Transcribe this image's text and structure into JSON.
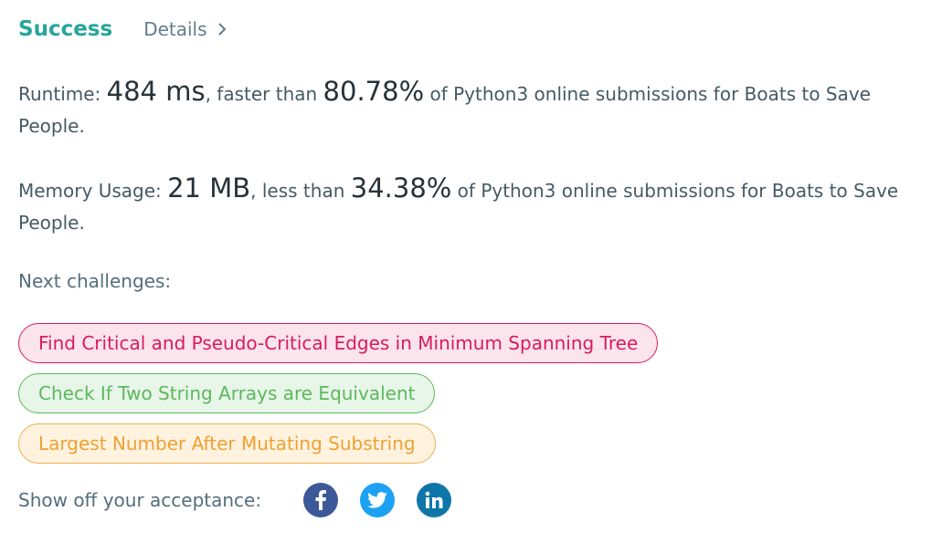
{
  "header": {
    "status": "Success",
    "details_label": "Details"
  },
  "runtime": {
    "label": "Runtime:",
    "value": "484 ms",
    "comparison": ", faster than ",
    "percent": "80.78%",
    "suffix": " of Python3 online submissions for Boats to Save People."
  },
  "memory": {
    "label": "Memory Usage:",
    "value": "21 MB",
    "comparison": ", less than ",
    "percent": "34.38%",
    "suffix": " of Python3 online submissions for Boats to Save People."
  },
  "next": {
    "label": "Next challenges:",
    "items": [
      {
        "title": "Find Critical and Pseudo-Critical Edges in Minimum Spanning Tree",
        "difficulty_color": "#d81b60"
      },
      {
        "title": "Check If Two String Arrays are Equivalent",
        "difficulty_color": "#5cb85c"
      },
      {
        "title": "Largest Number After Mutating Substring",
        "difficulty_color": "#f0ad4e"
      }
    ]
  },
  "share": {
    "label": "Show off your acceptance:",
    "icons": [
      "facebook-icon",
      "twitter-icon",
      "linkedin-icon"
    ],
    "colors": {
      "facebook": "#3b5998",
      "twitter": "#1da1f2",
      "linkedin": "#0e76a8"
    }
  }
}
